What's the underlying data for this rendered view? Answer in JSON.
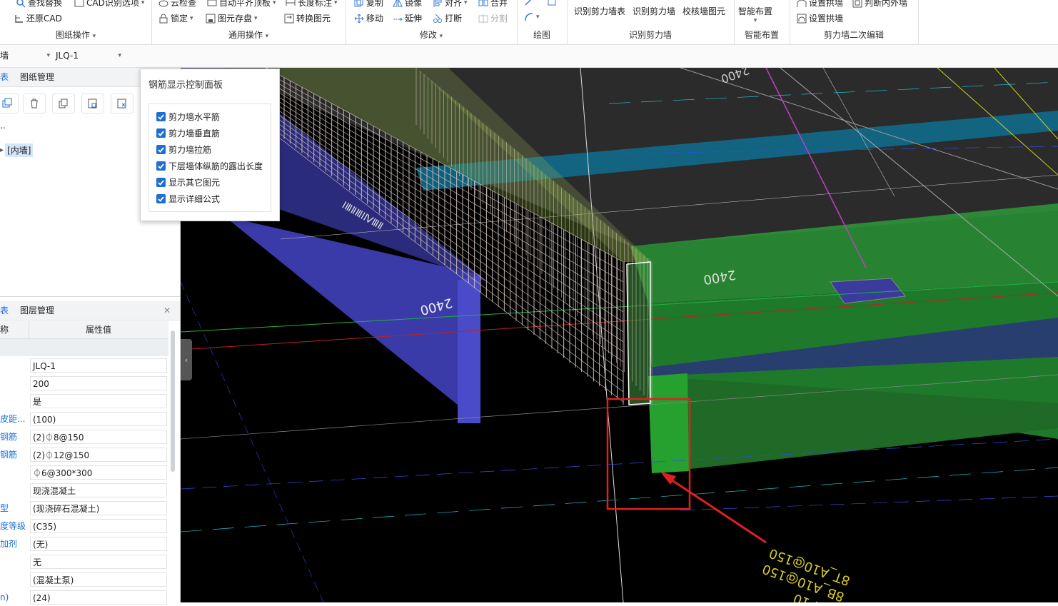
{
  "ribbon": {
    "groups": [
      {
        "label": "图纸操作",
        "buttons": [
          "查找替换",
          "CAD识别选项",
          "还原CAD"
        ]
      },
      {
        "label": "通用操作",
        "buttons": [
          "云检查",
          "自动平齐顶板",
          "长度标注",
          "锁定",
          "图元存盘",
          "转换图元"
        ]
      },
      {
        "label": "修改",
        "buttons": [
          "复制",
          "镜像",
          "对齐",
          "合并",
          "移动",
          "延伸",
          "打断",
          "分割"
        ]
      },
      {
        "label": "绘图"
      },
      {
        "label": "识别剪力墙",
        "buttons": [
          "识别剪力墙表",
          "识别剪力墙",
          "校核墙图元"
        ]
      },
      {
        "label": "智能布置",
        "buttons": [
          "智能布置"
        ]
      },
      {
        "label": "剪力墙二次编辑",
        "buttons": [
          "设置拱墙",
          "判断内外墙",
          "设置拱墙"
        ]
      }
    ]
  },
  "toolbar": {
    "type_value": "墙",
    "name_value": "JLQ-1"
  },
  "left_top": {
    "tabs": [
      "表",
      "图纸管理"
    ],
    "dots": "..",
    "tree_item": "[内墙]"
  },
  "left_bottom": {
    "tabs": [
      "表",
      "图层管理"
    ],
    "col_name": "称",
    "col_value": "属性值"
  },
  "properties": [
    {
      "name": "",
      "value": "JLQ-1"
    },
    {
      "name": "",
      "value": "200"
    },
    {
      "name": "",
      "value": "是"
    },
    {
      "name": "皮距...",
      "value": "(100)"
    },
    {
      "name": "钢筋",
      "value": "(2)⏀8@150"
    },
    {
      "name": "钢筋",
      "value": "(2)⏀12@150"
    },
    {
      "name": "",
      "value": "⏀6@300*300"
    },
    {
      "name": "",
      "value": "现浇混凝土"
    },
    {
      "name": "型",
      "value": "(现浇碎石混凝土)"
    },
    {
      "name": "度等级",
      "value": "(C35)"
    },
    {
      "name": "加剂",
      "value": "(无)"
    },
    {
      "name": "",
      "value": "无"
    },
    {
      "name": "",
      "value": "(混凝土泵)"
    },
    {
      "name": "n)",
      "value": "(24)"
    }
  ],
  "control_panel": {
    "title": "钢筋显示控制面板",
    "options": [
      "剪力墙水平筋",
      "剪力墙垂直筋",
      "剪力墙拉筋",
      "下层墙体纵筋的露出长度",
      "显示其它图元",
      "显示详细公式"
    ]
  },
  "viewport": {
    "dim_labels": [
      "2400",
      "2400",
      "2400"
    ],
    "beam_label_lines": [
      "LBH-10",
      "8B_A10@150",
      "8T_A10@150"
    ],
    "wall_mark": "ⅠⅢⅡⅢⅠⅣⅢⅡ",
    "highlight_color": "#e02020"
  }
}
